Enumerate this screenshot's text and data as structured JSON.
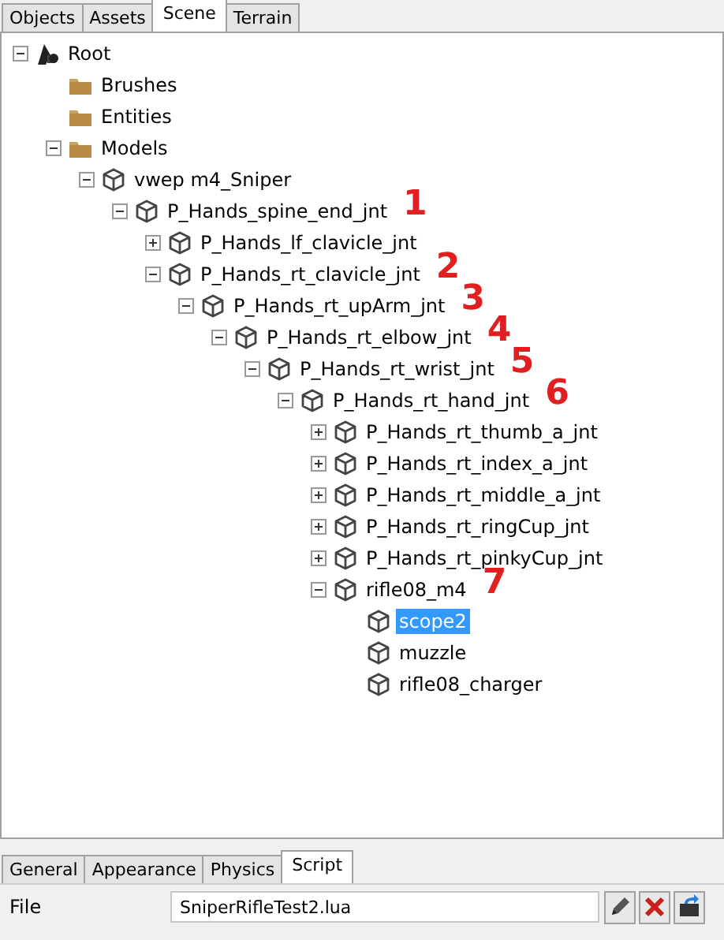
{
  "top_tabs": [
    {
      "label": "Objects",
      "selected": false
    },
    {
      "label": "Assets",
      "selected": false
    },
    {
      "label": "Scene",
      "selected": true
    },
    {
      "label": "Terrain",
      "selected": false
    }
  ],
  "tree": [
    {
      "label": "Root",
      "kind": "root",
      "expanded": true,
      "selected": false,
      "children": [
        {
          "label": "Brushes",
          "kind": "folder",
          "selected": false
        },
        {
          "label": "Entities",
          "kind": "folder",
          "selected": false
        },
        {
          "label": "Models",
          "kind": "folder",
          "expanded": true,
          "selected": false,
          "children": [
            {
              "label": "vwep m4_Sniper",
              "kind": "object",
              "expanded": true,
              "selected": false,
              "children": [
                {
                  "label": "P_Hands_spine_end_jnt",
                  "kind": "object",
                  "expanded": true,
                  "selected": false,
                  "annotation": "1",
                  "children": [
                    {
                      "label": "P_Hands_lf_clavicle_jnt",
                      "kind": "object",
                      "expanded": false,
                      "selected": false
                    },
                    {
                      "label": "P_Hands_rt_clavicle_jnt",
                      "kind": "object",
                      "expanded": true,
                      "selected": false,
                      "annotation": "2",
                      "children": [
                        {
                          "label": "P_Hands_rt_upArm_jnt",
                          "kind": "object",
                          "expanded": true,
                          "selected": false,
                          "annotation": "3",
                          "children": [
                            {
                              "label": "P_Hands_rt_elbow_jnt",
                              "kind": "object",
                              "expanded": true,
                              "selected": false,
                              "annotation": "4",
                              "children": [
                                {
                                  "label": "P_Hands_rt_wrist_jnt",
                                  "kind": "object",
                                  "expanded": true,
                                  "selected": false,
                                  "annotation": "5",
                                  "children": [
                                    {
                                      "label": "P_Hands_rt_hand_jnt",
                                      "kind": "object",
                                      "expanded": true,
                                      "selected": false,
                                      "annotation": "6",
                                      "children": [
                                        {
                                          "label": "P_Hands_rt_thumb_a_jnt",
                                          "kind": "object",
                                          "expanded": false,
                                          "selected": false
                                        },
                                        {
                                          "label": "P_Hands_rt_index_a_jnt",
                                          "kind": "object",
                                          "expanded": false,
                                          "selected": false
                                        },
                                        {
                                          "label": "P_Hands_rt_middle_a_jnt",
                                          "kind": "object",
                                          "expanded": false,
                                          "selected": false
                                        },
                                        {
                                          "label": "P_Hands_rt_ringCup_jnt",
                                          "kind": "object",
                                          "expanded": false,
                                          "selected": false
                                        },
                                        {
                                          "label": "P_Hands_rt_pinkyCup_jnt",
                                          "kind": "object",
                                          "expanded": false,
                                          "selected": false
                                        },
                                        {
                                          "label": "rifle08_m4",
                                          "kind": "object",
                                          "expanded": true,
                                          "selected": false,
                                          "annotation": "7",
                                          "children": [
                                            {
                                              "label": "scope2",
                                              "kind": "object",
                                              "selected": true
                                            },
                                            {
                                              "label": "muzzle",
                                              "kind": "object",
                                              "selected": false
                                            },
                                            {
                                              "label": "rifle08_charger",
                                              "kind": "object",
                                              "selected": false
                                            }
                                          ]
                                        }
                                      ]
                                    }
                                  ]
                                }
                              ]
                            }
                          ]
                        }
                      ]
                    }
                  ]
                }
              ]
            }
          ]
        }
      ]
    }
  ],
  "bottom_tabs": [
    {
      "label": "General",
      "selected": false
    },
    {
      "label": "Appearance",
      "selected": false
    },
    {
      "label": "Physics",
      "selected": false
    },
    {
      "label": "Script",
      "selected": true
    }
  ],
  "file_row": {
    "label": "File",
    "value": "SniperRifleTest2.lua"
  }
}
